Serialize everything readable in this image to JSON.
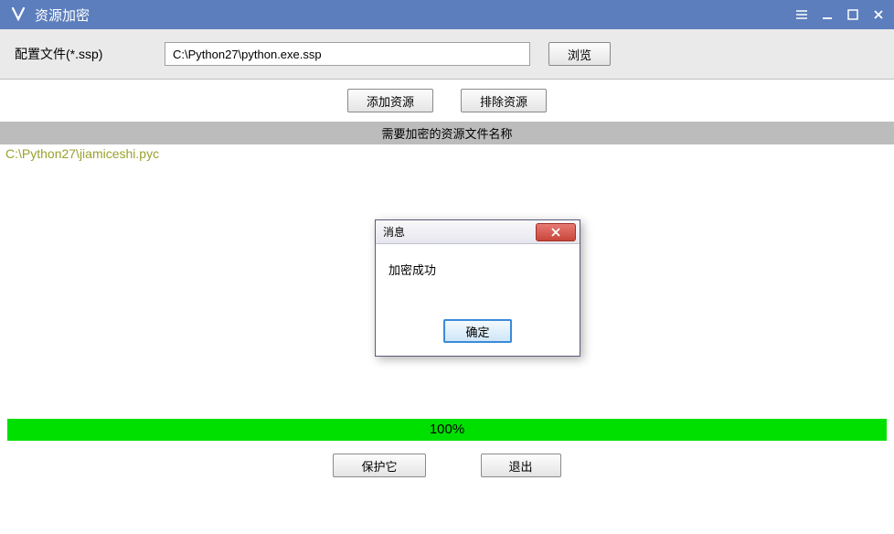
{
  "window": {
    "title": "资源加密"
  },
  "config": {
    "label": "配置文件(*.ssp)",
    "path": "C:\\Python27\\python.exe.ssp",
    "browse": "浏览"
  },
  "actions": {
    "add": "添加资源",
    "remove": "排除资源"
  },
  "list": {
    "header": "需要加密的资源文件名称",
    "items": [
      "C:\\Python27\\jiamiceshi.pyc"
    ]
  },
  "progress": {
    "text": "100%"
  },
  "bottom": {
    "protect": "保护它",
    "exit": "退出"
  },
  "dialog": {
    "title": "消息",
    "message": "加密成功",
    "ok": "确定"
  }
}
